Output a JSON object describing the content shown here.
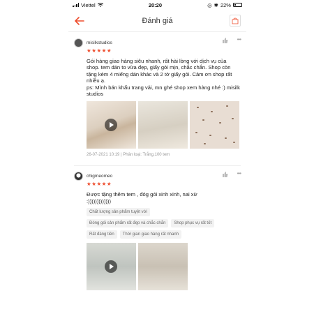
{
  "status_bar": {
    "carrier": "Viettel",
    "time": "20:20",
    "battery": "22%"
  },
  "header": {
    "title": "Đánh giá"
  },
  "reviews": [
    {
      "username": "misilkstudios",
      "stars": "★★★★★",
      "text": "Gói hàng giao hàng siêu nhanh, rất hài lòng với dịch vụ của shop. tem dán to vừa đẹp, giấy gói mịn, chắc chắn. Shop còn tặng kèm 4 miếng dán khác và 2 tờ giấy gói. Cảm ơn shop rất nhiều ạ.\nps: Mình bán khẩu trang vải, mn ghé shop xem hàng nhé :) misilk studios",
      "meta": "26-07-2021 10:19 | Phân loại: Trắng,100 tem"
    },
    {
      "username": "chigmeomeo",
      "stars": "★★★★★",
      "text": "Được tặng thêm tem , đóg gói xinh xinh, nai xừ :)))))))))))))",
      "tags": [
        "Chất lượng sản phẩm tuyệt vời",
        "Đóng gói sản phẩm rất đẹp và chắc chắn",
        "Shop phục vụ rất tốt",
        "Rất đáng tiền",
        "Thời gian giao hàng rất nhanh"
      ]
    }
  ],
  "colors": {
    "accent": "#ee4d2d",
    "meta_text": "#999999",
    "tag_bg": "#f2f2f2"
  },
  "icons": [
    "back-arrow-icon",
    "cart-icon",
    "like-icon",
    "more-icon",
    "play-icon",
    "wifi-icon",
    "battery-icon",
    "signal-icon"
  ]
}
